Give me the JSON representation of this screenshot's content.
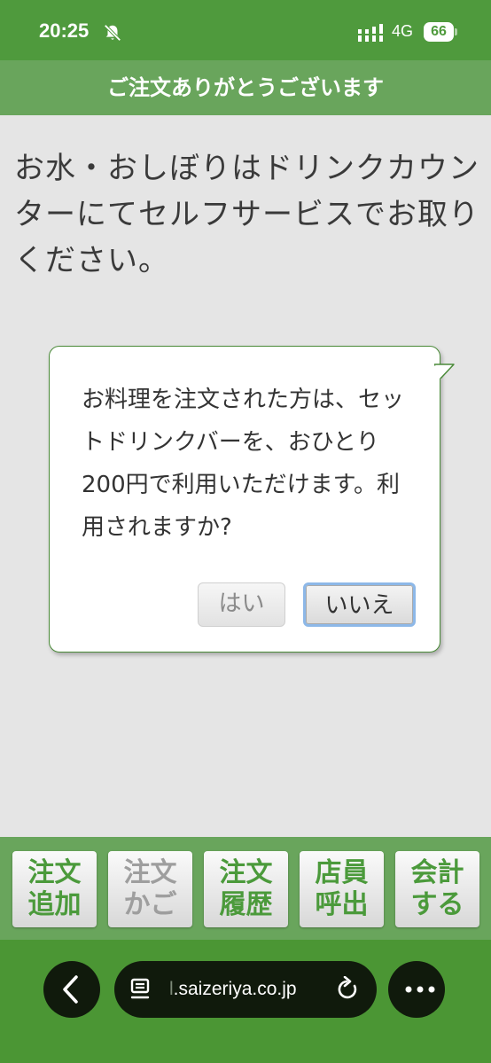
{
  "status_bar": {
    "time": "20:25",
    "network": "4G",
    "battery": "66"
  },
  "header": {
    "title": "ご注文ありがとうございます"
  },
  "notice": {
    "text": "お水・おしぼりはドリンクカウンターにてセルフサービスでお取りください。"
  },
  "dialog": {
    "message": "お料理を注文された方は、セットドリンクバーを、おひとり200円で利用いただけます。利用されますか?",
    "yes_label": "はい",
    "no_label": "いいえ"
  },
  "bottom_nav": {
    "items": [
      {
        "line1": "注文",
        "line2": "追加",
        "enabled": true
      },
      {
        "line1": "注文",
        "line2": "かご",
        "enabled": false
      },
      {
        "line1": "注文",
        "line2": "履歴",
        "enabled": true
      },
      {
        "line1": "店員",
        "line2": "呼出",
        "enabled": true
      },
      {
        "line1": "会計",
        "line2": "する",
        "enabled": true
      }
    ]
  },
  "browser": {
    "url_prefix": "l",
    "url": ".saizeriya.co.jp"
  },
  "colors": {
    "brand_green": "#4f9a3d",
    "header_green": "#69a55c",
    "nav_text_green": "#4b9a3b",
    "dialog_border": "#4a8a38",
    "focus_ring": "#8db8e8"
  },
  "icons": [
    "bell-muted-icon",
    "signal-icon",
    "battery-icon",
    "back-arrow-icon",
    "tabs-icon",
    "reload-icon",
    "more-icon"
  ]
}
